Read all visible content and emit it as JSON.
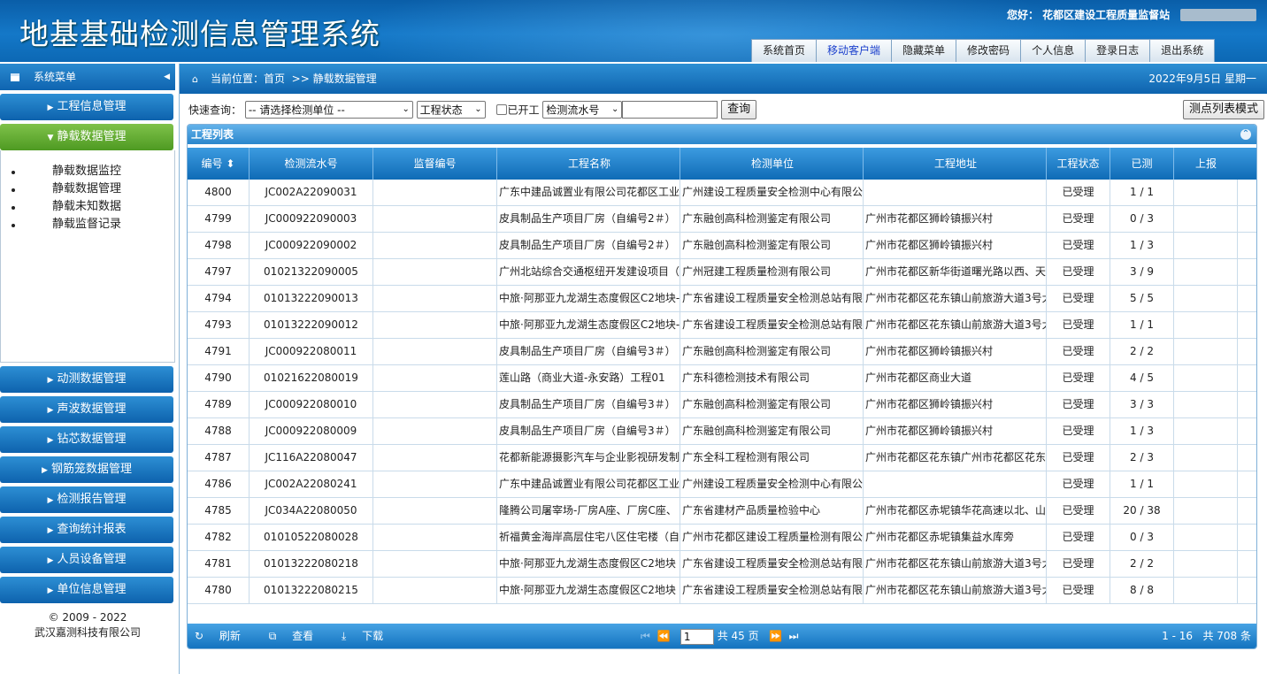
{
  "app": {
    "title": "地基基础检测信息管理系统",
    "greeting": "您好： 花都区建设工程质量监督站"
  },
  "topnav": [
    "系统首页",
    "移动客户端",
    "隐藏菜单",
    "修改密码",
    "个人信息",
    "登录日志",
    "退出系统"
  ],
  "sidebar": {
    "header": "系统菜单",
    "menus_top": [
      "工程信息管理",
      "静载数据管理"
    ],
    "submenu": [
      "静载数据监控",
      "静载数据管理",
      "静载未知数据",
      "静载监督记录"
    ],
    "menus_bottom": [
      "动测数据管理",
      "声波数据管理",
      "钻芯数据管理",
      "钢筋笼数据管理",
      "检测报告管理",
      "查询统计报表",
      "人员设备管理",
      "单位信息管理"
    ],
    "copyright": "© 2009 - 2022",
    "company": "武汉嘉测科技有限公司"
  },
  "crumb": {
    "label": "当前位置：首页",
    "page": ">> 静载数据管理",
    "date": "2022年9月5日 星期一"
  },
  "query": {
    "label": "快速查询：",
    "unit_select": "-- 请选择检测单位 --",
    "status_select": "工程状态",
    "started_label": "已开工",
    "serial_select": "检测流水号",
    "search_button": "查询",
    "mode_button": "测点列表模式"
  },
  "panel": {
    "title": "工程列表"
  },
  "table": {
    "headers": [
      "编号",
      "检测流水号",
      "监督编号",
      "工程名称",
      "检测单位",
      "工程地址",
      "工程状态",
      "已测",
      "上报"
    ],
    "rows": [
      {
        "id": "4800",
        "serial": "JC002A22090031",
        "sup": "",
        "name": "广东中建品诚置业有限公司花都区工业",
        "unit": "广州建设工程质量安全检测中心有限公",
        "addr": "",
        "status": "已受理",
        "done": "1 / 1"
      },
      {
        "id": "4799",
        "serial": "JC000922090003",
        "sup": "",
        "name": "皮具制品生产项目厂房（自编号2＃）",
        "unit": "广东融创高科检测鉴定有限公司",
        "addr": "广州市花都区狮岭镇振兴村",
        "status": "已受理",
        "done": "0 / 3"
      },
      {
        "id": "4798",
        "serial": "JC000922090002",
        "sup": "",
        "name": "皮具制品生产项目厂房（自编号2＃）",
        "unit": "广东融创高科检测鉴定有限公司",
        "addr": "广州市花都区狮岭镇振兴村",
        "status": "已受理",
        "done": "1 / 3"
      },
      {
        "id": "4797",
        "serial": "01021322090005",
        "sup": "",
        "name": "广州北站综合交通枢纽开发建设项目（",
        "unit": "广州冠建工程质量检测有限公司",
        "addr": "广州市花都区新华街道曙光路以西、天",
        "status": "已受理",
        "done": "3 / 9"
      },
      {
        "id": "4794",
        "serial": "01013222090013",
        "sup": "",
        "name": "中旅·阿那亚九龙湖生态度假区C2地块-",
        "unit": "广东省建设工程质量安全检测总站有限",
        "addr": "广州市花都区花东镇山前旅游大道3号大",
        "status": "已受理",
        "done": "5 / 5"
      },
      {
        "id": "4793",
        "serial": "01013222090012",
        "sup": "",
        "name": "中旅·阿那亚九龙湖生态度假区C2地块-",
        "unit": "广东省建设工程质量安全检测总站有限",
        "addr": "广州市花都区花东镇山前旅游大道3号大",
        "status": "已受理",
        "done": "1 / 1"
      },
      {
        "id": "4791",
        "serial": "JC000922080011",
        "sup": "",
        "name": "皮具制品生产项目厂房（自编号3＃）",
        "unit": "广东融创高科检测鉴定有限公司",
        "addr": "广州市花都区狮岭镇振兴村",
        "status": "已受理",
        "done": "2 / 2"
      },
      {
        "id": "4790",
        "serial": "01021622080019",
        "sup": "",
        "name": "莲山路（商业大道-永安路）工程01",
        "unit": "广东科德检测技术有限公司",
        "addr": "广州市花都区商业大道",
        "status": "已受理",
        "done": "4 / 5"
      },
      {
        "id": "4789",
        "serial": "JC000922080010",
        "sup": "",
        "name": "皮具制品生产项目厂房（自编号3＃）",
        "unit": "广东融创高科检测鉴定有限公司",
        "addr": "广州市花都区狮岭镇振兴村",
        "status": "已受理",
        "done": "3 / 3"
      },
      {
        "id": "4788",
        "serial": "JC000922080009",
        "sup": "",
        "name": "皮具制品生产项目厂房（自编号3＃）",
        "unit": "广东融创高科检测鉴定有限公司",
        "addr": "广州市花都区狮岭镇振兴村",
        "status": "已受理",
        "done": "1 / 3"
      },
      {
        "id": "4787",
        "serial": "JC116A22080047",
        "sup": "",
        "name": "花都新能源摄影汽车与企业影视研发制",
        "unit": "广东全科工程检测有限公司",
        "addr": "广州市花都区花东镇广州市花都区花东",
        "status": "已受理",
        "done": "2 / 3"
      },
      {
        "id": "4786",
        "serial": "JC002A22080241",
        "sup": "",
        "name": "广东中建品诚置业有限公司花都区工业",
        "unit": "广州建设工程质量安全检测中心有限公",
        "addr": "",
        "status": "已受理",
        "done": "1 / 1"
      },
      {
        "id": "4785",
        "serial": "JC034A22080050",
        "sup": "",
        "name": "隆腾公司屠宰场-厂房A座、厂房C座、",
        "unit": "广东省建材产品质量检验中心",
        "addr": "广州市花都区赤坭镇华花高速以北、山",
        "status": "已受理",
        "done": "20 / 38"
      },
      {
        "id": "4782",
        "serial": "01010522080028",
        "sup": "",
        "name": "祈福黄金海岸高层住宅八区住宅楼（自",
        "unit": "广州市花都区建设工程质量检测有限公",
        "addr": "广州市花都区赤坭镇集益水库旁",
        "status": "已受理",
        "done": "0 / 3"
      },
      {
        "id": "4781",
        "serial": "01013222080218",
        "sup": "",
        "name": "中旅·阿那亚九龙湖生态度假区C2地块",
        "unit": "广东省建设工程质量安全检测总站有限",
        "addr": "广州市花都区花东镇山前旅游大道3号大",
        "status": "已受理",
        "done": "2 / 2"
      },
      {
        "id": "4780",
        "serial": "01013222080215",
        "sup": "",
        "name": "中旅·阿那亚九龙湖生态度假区C2地块",
        "unit": "广东省建设工程质量安全检测总站有限",
        "addr": "广州市花都区花东镇山前旅游大道3号大",
        "status": "已受理",
        "done": "8 / 8"
      }
    ]
  },
  "pager": {
    "refresh": "刷新",
    "view": "查看",
    "download": "下载",
    "page": "1",
    "total_pages": "共 45 页",
    "range": "1 - 16",
    "total": "共 708 条"
  }
}
